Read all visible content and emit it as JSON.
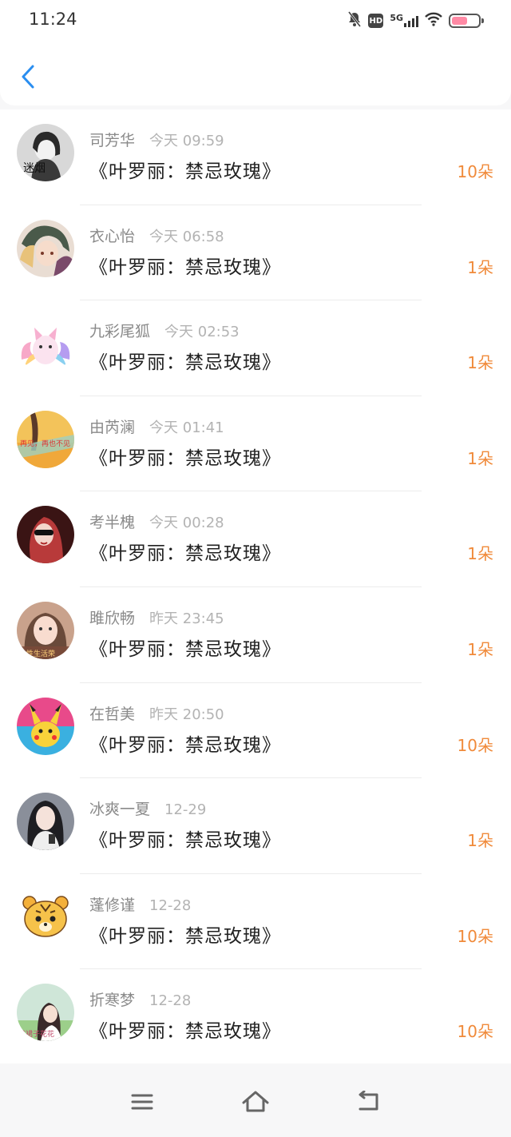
{
  "status_bar": {
    "time": "11:24",
    "hd": "HD",
    "network": "5G",
    "battery_level": 0.6
  },
  "header": {
    "back_icon": "chevron-left-icon"
  },
  "list": [
    {
      "name": "司芳华",
      "time": "今天 09:59",
      "title": "《叶罗丽：禁忌玫瑰》",
      "amount": "10朵"
    },
    {
      "name": "衣心怡",
      "time": "今天 06:58",
      "title": "《叶罗丽：禁忌玫瑰》",
      "amount": "1朵"
    },
    {
      "name": "九彩尾狐",
      "time": "今天 02:53",
      "title": "《叶罗丽：禁忌玫瑰》",
      "amount": "1朵"
    },
    {
      "name": "由芮澜",
      "time": "今天 01:41",
      "title": "《叶罗丽：禁忌玫瑰》",
      "amount": "1朵"
    },
    {
      "name": "考半槐",
      "time": "今天 00:28",
      "title": "《叶罗丽：禁忌玫瑰》",
      "amount": "1朵"
    },
    {
      "name": "雎欣畅",
      "time": "昨天 23:45",
      "title": "《叶罗丽：禁忌玫瑰》",
      "amount": "1朵"
    },
    {
      "name": "在哲美",
      "time": "昨天 20:50",
      "title": "《叶罗丽：禁忌玫瑰》",
      "amount": "10朵"
    },
    {
      "name": "冰爽一夏",
      "time": "12-29",
      "title": "《叶罗丽：禁忌玫瑰》",
      "amount": "1朵"
    },
    {
      "name": "蓬修谨",
      "time": "12-28",
      "title": "《叶罗丽：禁忌玫瑰》",
      "amount": "10朵"
    },
    {
      "name": "折寒梦",
      "time": "12-28",
      "title": "《叶罗丽：禁忌玫瑰》",
      "amount": "10朵"
    }
  ],
  "colors": {
    "accent": "#2a8ef0",
    "amount": "#f08a3a",
    "name": "#8a8a8a",
    "time": "#b3b3b3"
  },
  "nav_bar": {
    "menu_icon": "menu-icon",
    "home_icon": "home-icon",
    "back_icon": "back-icon"
  }
}
